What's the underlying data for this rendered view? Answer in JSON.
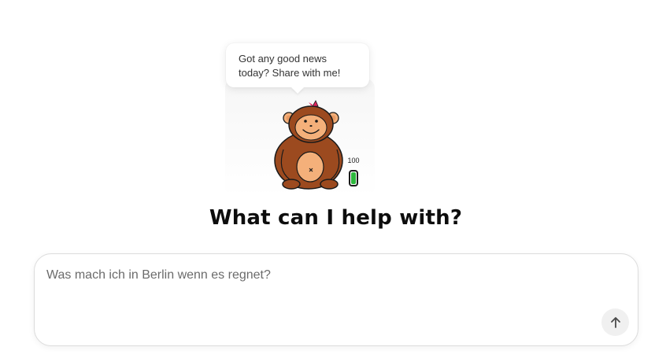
{
  "companion": {
    "speech_bubble": {
      "text": "Got any good news\ntoday? Share with me!"
    },
    "avatar_icon": "monkey-icon",
    "battery": {
      "label": "100",
      "level": 1.0,
      "color": "#2db83d"
    }
  },
  "main": {
    "heading": "What can I help with?"
  },
  "composer": {
    "placeholder": "Was mach ich in Berlin wenn es regnet?",
    "send_icon": "arrow-up-icon"
  },
  "colors": {
    "heading": "#0d0d0d",
    "monkey_fur": "#9c4a1f",
    "monkey_face": "#f4b07a",
    "bow": "#e0245e"
  }
}
